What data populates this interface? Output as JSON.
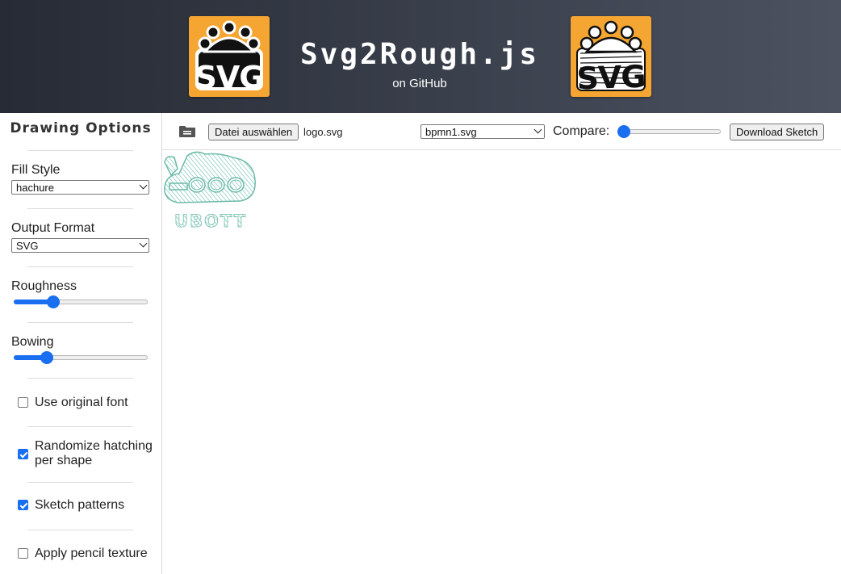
{
  "header": {
    "title": "Svg2Rough.js",
    "subtitle": "on GitHub",
    "logo_left_text": "SVG",
    "logo_right_text": "SVG",
    "logo_color": "#f5a531"
  },
  "sidebar": {
    "heading": "Drawing Options",
    "fill_style": {
      "label": "Fill Style",
      "value": "hachure"
    },
    "output_format": {
      "label": "Output Format",
      "value": "SVG"
    },
    "roughness": {
      "label": "Roughness",
      "level": 0.27
    },
    "bowing": {
      "label": "Bowing",
      "level": 0.22
    },
    "checkboxes": [
      {
        "label": "Use original font",
        "checked": false
      },
      {
        "label": "Randomize hatching per shape",
        "checked": true
      },
      {
        "label": "Sketch patterns",
        "checked": true
      },
      {
        "label": "Apply pencil texture",
        "checked": false
      }
    ]
  },
  "toolbar": {
    "folder_icon": "folder-icon",
    "file_button_label": "Datei auswählen",
    "file_name": "logo.svg",
    "example_select_value": "bpmn1.svg",
    "compare_label": "Compare:",
    "compare_level": 0.0,
    "download_label": "Download Sketch",
    "accent_color": "#1a6ef0"
  },
  "canvas": {
    "sketch_text": "UBOTT",
    "sketch_color": "#7fc7b8"
  }
}
